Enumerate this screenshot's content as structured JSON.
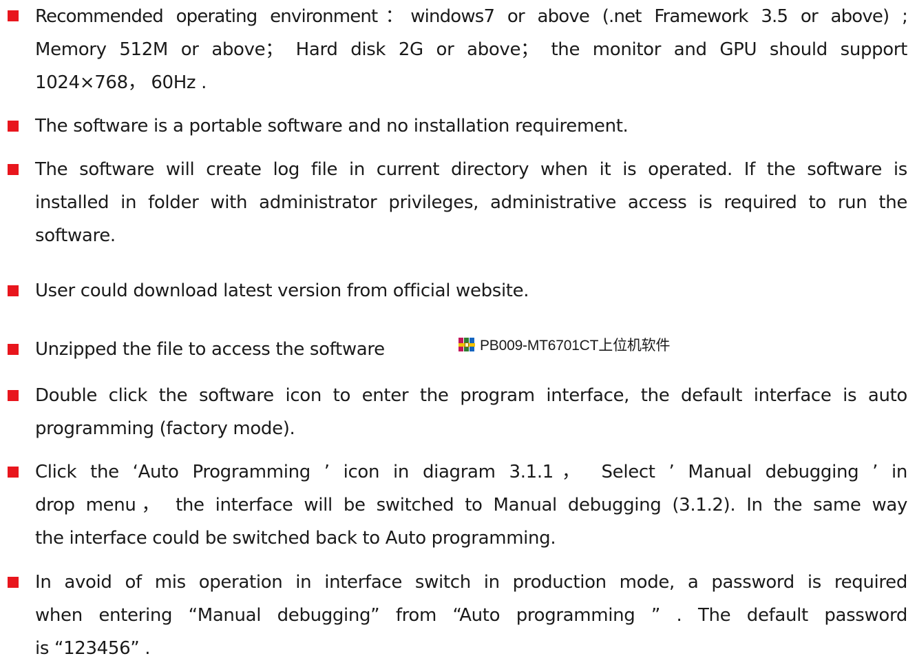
{
  "items": [
    {
      "lines": [
        "Recommended operating environment：windows7 or above (.net Framework 3.5 or above) ;",
        "Memory 512M or above； Hard disk 2G or above； the monitor and GPU should support",
        "1024×768， 60Hz ."
      ]
    },
    {
      "lines": [
        "The software is a portable software and no installation requirement."
      ]
    },
    {
      "lines": [
        "The software will create log file in current directory when it is operated. If the software is",
        "installed in folder with administrator privileges, administrative access is required to run the",
        "software."
      ]
    },
    {
      "lines": [
        "User could download latest version from official website."
      ]
    },
    {
      "lines": [
        "Unzipped the file to access the software"
      ],
      "file_icon": "winrar-archive-icon",
      "file_name": "PB009-MT6701CT上位机软件"
    },
    {
      "lines": [
        "Double click the software icon to enter the program interface, the default interface is auto",
        "programming (factory mode)."
      ]
    },
    {
      "lines": [
        "Click the  ‘Auto Programming ’ icon in diagram 3.1.1， Select ’ Manual debugging  ’ in",
        "drop menu， the interface will be switched to Manual debugging (3.1.2). In the same way",
        "the interface could be switched back to Auto programming."
      ]
    },
    {
      "lines": [
        "In avoid of mis operation in interface switch in production mode, a password is required",
        "when entering  “Manual debugging”  from  “Auto programming ” . The default password",
        "is  “123456” ."
      ]
    }
  ],
  "colors": {
    "bullet": "#e8161d",
    "text": "#1a1a1a"
  }
}
